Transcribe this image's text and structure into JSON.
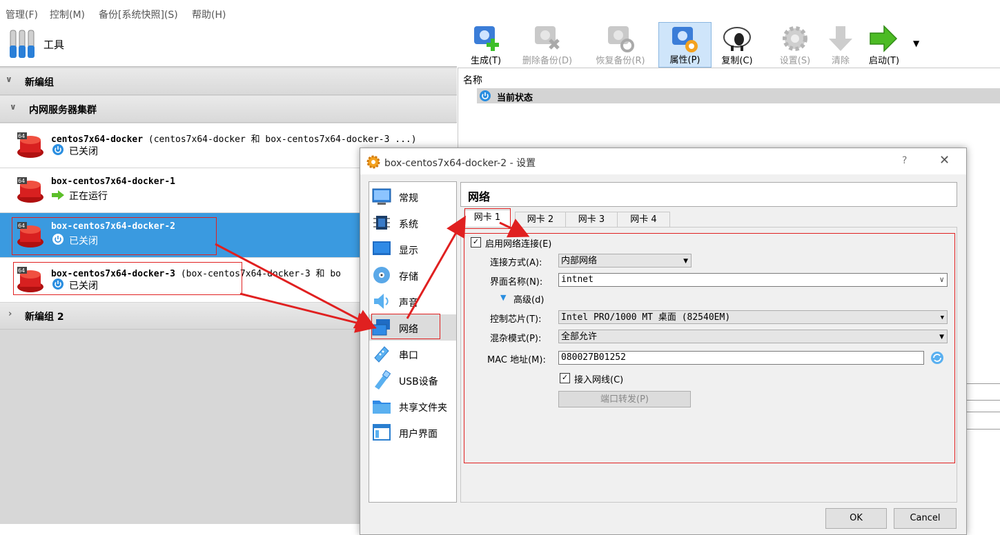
{
  "menubar": {
    "items": [
      "管理(F)",
      "控制(M)",
      "备份[系统快照](S)",
      "帮助(H)"
    ]
  },
  "tools": {
    "label": "工具"
  },
  "groups": [
    {
      "name": "新编组",
      "expanded": true
    },
    {
      "name": "内网服务器集群",
      "expanded": true
    },
    {
      "name": "新编组 2",
      "expanded": false
    }
  ],
  "vms": [
    {
      "name": "centos7x64-docker",
      "extra": "(centos7x64-docker 和 box-centos7x64-docker-3 ...)",
      "status": "已关闭",
      "state": "off"
    },
    {
      "name": "box-centos7x64-docker-1",
      "extra": "",
      "status": "正在运行",
      "state": "running"
    },
    {
      "name": "box-centos7x64-docker-2",
      "extra": "",
      "status": "已关闭",
      "state": "off",
      "selected": true
    },
    {
      "name": "box-centos7x64-docker-3",
      "extra": "(box-centos7x64-docker-3 和 bo",
      "status": "已关闭",
      "state": "off"
    }
  ],
  "toolbar": {
    "new": "生成(T)",
    "delete_snapshot": "删除备份(D)",
    "restore_snapshot": "恢复备份(R)",
    "properties": "属性(P)",
    "clone": "复制(C)",
    "settings": "设置(S)",
    "discard": "清除",
    "start": "启动(T)"
  },
  "details": {
    "column_header": "名称",
    "current_state": "当前状态"
  },
  "dialog": {
    "title": "box-centos7x64-docker-2 - 设置",
    "help": "?",
    "nav": [
      "常规",
      "系统",
      "显示",
      "存储",
      "声音",
      "网络",
      "串口",
      "USB设备",
      "共享文件夹",
      "用户界面"
    ],
    "nav_selected": "网络",
    "section_title": "网络",
    "tabs": [
      "网卡 1",
      "网卡 2",
      "网卡 3",
      "网卡 4"
    ],
    "enable_adapter": "启用网络连接(E)",
    "attached_to_label": "连接方式(A):",
    "attached_to_value": "内部网络",
    "name_label": "界面名称(N):",
    "name_value": "intnet",
    "advanced": "高级(d)",
    "adapter_type_label": "控制芯片(T):",
    "adapter_type_value": "Intel PRO/1000 MT 桌面 (82540EM)",
    "promisc_label": "混杂模式(P):",
    "promisc_value": "全部允许",
    "mac_label": "MAC 地址(M):",
    "mac_value": "080027B01252",
    "cable_connected": "接入网线(C)",
    "port_forwarding": "端口转发(P)",
    "ok": "OK",
    "cancel": "Cancel"
  },
  "colors": {
    "selection": "#3a9ae0",
    "annotation": "#e02020",
    "accent": "#2a8ee0"
  }
}
